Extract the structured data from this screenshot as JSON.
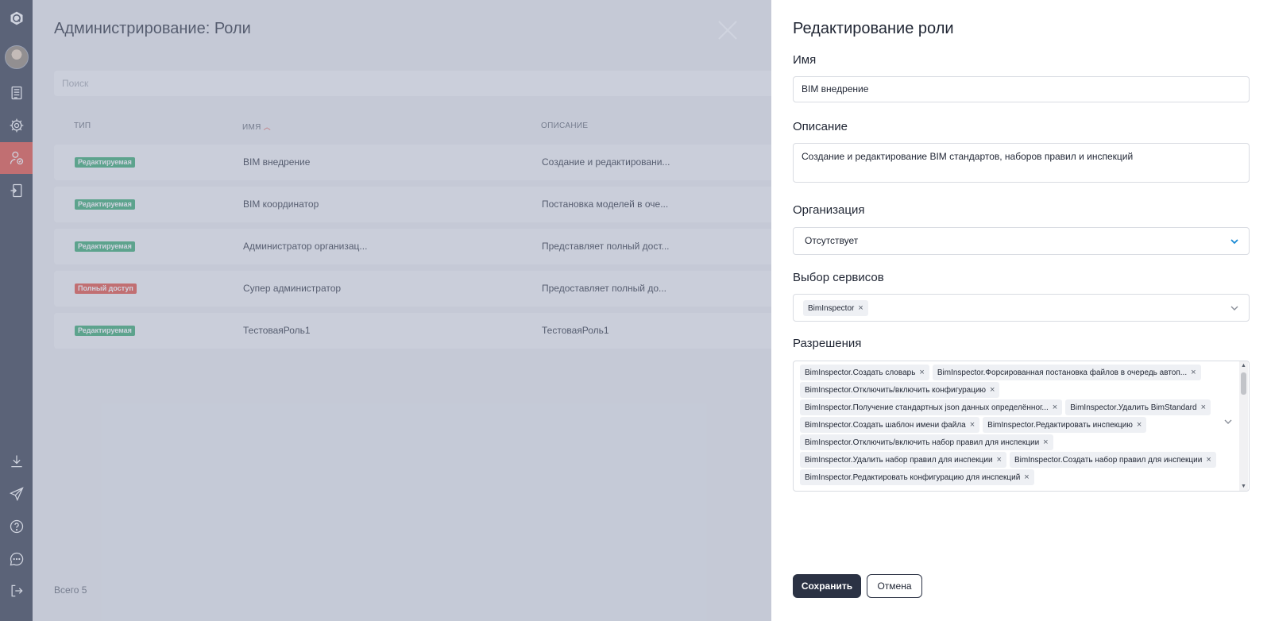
{
  "sidebar": {
    "items": [
      {
        "icon": "logo-icon"
      },
      {
        "icon": "avatar"
      },
      {
        "icon": "document-list-icon"
      },
      {
        "icon": "gear-icon"
      },
      {
        "icon": "user-roles-icon",
        "active": true
      },
      {
        "icon": "exit-board-icon"
      },
      {
        "icon": "download-icon"
      },
      {
        "icon": "send-icon"
      },
      {
        "icon": "help-icon"
      },
      {
        "icon": "chat-icon"
      },
      {
        "icon": "logout-icon"
      }
    ]
  },
  "main": {
    "title": "Администрирование: Роли",
    "search_placeholder": "Поиск",
    "columns": {
      "type": "ТИП",
      "name": "ИМЯ",
      "description": "ОПИСАНИЕ"
    },
    "rows": [
      {
        "badge": "Редактируемая",
        "badge_color": "#2ea66a",
        "name": "BIM внедрение",
        "description": "Создание и редактировани..."
      },
      {
        "badge": "Редактируемая",
        "badge_color": "#2ea66a",
        "name": "BIM координатор",
        "description": "Постановка моделей в оче..."
      },
      {
        "badge": "Редактируемая",
        "badge_color": "#2ea66a",
        "name": "Администратор организац...",
        "description": "Представляет полный дост..."
      },
      {
        "badge": "Полный доступ",
        "badge_color": "#e4483a",
        "name": "Супер администратор",
        "description": "Предоставляет полный до..."
      },
      {
        "badge": "Редактируемая",
        "badge_color": "#2ea66a",
        "name": "ТестоваяРоль1",
        "description": "ТестоваяРоль1"
      }
    ],
    "total": "Всего 5"
  },
  "panel": {
    "title": "Редактирование роли",
    "name_label": "Имя",
    "name_value": "BIM внедрение",
    "description_label": "Описание",
    "description_value": "Создание и редактирование BIM стандартов, наборов правил и инспекций",
    "organization_label": "Организация",
    "organization_value": "Отсутствует",
    "services_label": "Выбор сервисов",
    "services": [
      "BimInspector"
    ],
    "permissions_label": "Разрешения",
    "permissions": [
      [
        "BimInspector.Создать словарь",
        "BimInspector.Форсированная постановка файлов в очередь автоп..."
      ],
      [
        "BimInspector.Отключить/включить конфигурацию"
      ],
      [
        "BimInspector.Получение стандартных json данных определённог...",
        "BimInspector.Удалить BimStandard"
      ],
      [
        "BimInspector.Создать шаблон имени файла",
        "BimInspector.Редактировать инспекцию"
      ],
      [
        "BimInspector.Отключить/включить набор правил для инспекции"
      ],
      [
        "BimInspector.Удалить набор правил для инспекции",
        "BimInspector.Создать набор правил для инспекции"
      ],
      [
        "BimInspector.Редактировать конфигурацию для инспекций"
      ]
    ],
    "save_label": "Сохранить",
    "cancel_label": "Отмена",
    "accent_color": "#1a8ad4"
  }
}
